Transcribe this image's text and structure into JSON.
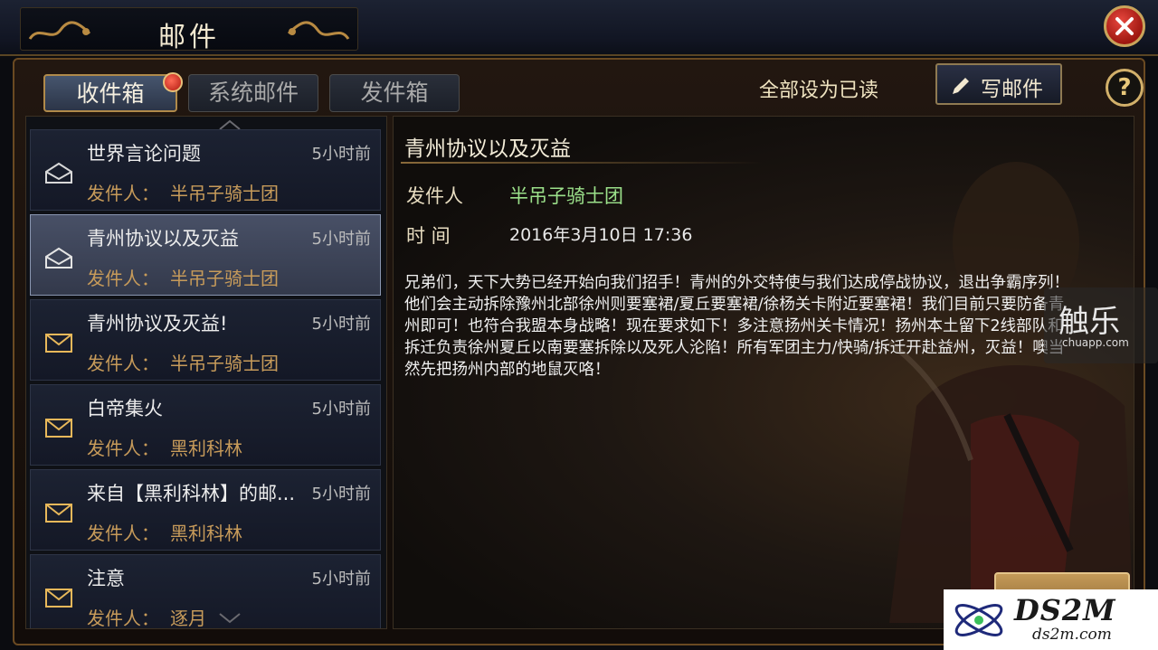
{
  "window": {
    "title": "邮件"
  },
  "tabs": [
    {
      "label": "收件箱",
      "active": true
    },
    {
      "label": "系统邮件",
      "active": false
    },
    {
      "label": "发件箱",
      "active": false
    }
  ],
  "toolbar": {
    "mark_all_read": "全部设为已读",
    "write_mail": "写邮件",
    "help": "?"
  },
  "mail_list": [
    {
      "subject": "世界言论问题",
      "time": "5小时前",
      "sender_label": "发件人：",
      "sender": "半吊子骑士团",
      "read": true,
      "selected": false
    },
    {
      "subject": "青州协议以及灭益",
      "time": "5小时前",
      "sender_label": "发件人：",
      "sender": "半吊子骑士团",
      "read": true,
      "selected": true
    },
    {
      "subject": "青州协议及灭益!",
      "time": "5小时前",
      "sender_label": "发件人：",
      "sender": "半吊子骑士团",
      "read": false,
      "selected": false
    },
    {
      "subject": "白帝集火",
      "time": "5小时前",
      "sender_label": "发件人：",
      "sender": "黑利科林",
      "read": false,
      "selected": false
    },
    {
      "subject": "来自【黑利科林】的邮...",
      "time": "5小时前",
      "sender_label": "发件人：",
      "sender": "黑利科林",
      "read": false,
      "selected": false
    },
    {
      "subject": "注意",
      "time": "5小时前",
      "sender_label": "发件人：",
      "sender": "逐月",
      "read": false,
      "selected": false
    }
  ],
  "detail": {
    "title": "青州协议以及灭益",
    "sender_label": "发件人",
    "sender": "半吊子骑士团",
    "time_label": "时  间",
    "time": "2016年3月10日 17:36",
    "body": "兄弟们，天下大势已经开始向我们招手！青州的外交特使与我们达成停战协议，退出争霸序列！他们会主动拆除豫州北部徐州则要塞裙/夏丘要塞裙/徐杨关卡附近要塞裙！我们目前只要防备青州即可！也符合我盟本身战略！现在要求如下！多注意扬州关卡情况！扬州本土留下2线部队和拆迁负责徐州夏丘以南要塞拆除以及死人沦陷！所有军团主力/快骑/拆迁开赴益州，灭益！噢当然先把扬州内部的地鼠灭咯！"
  },
  "watermarks": {
    "chuapp_big": "触乐",
    "chuapp_small": "chuapp.com",
    "ds2m_big": "DS2M",
    "ds2m_small": "ds2m.com"
  },
  "colors": {
    "sender_green": "#9be08a",
    "sender_gold": "#c79b5a",
    "accent_gold": "#b08a4a"
  }
}
